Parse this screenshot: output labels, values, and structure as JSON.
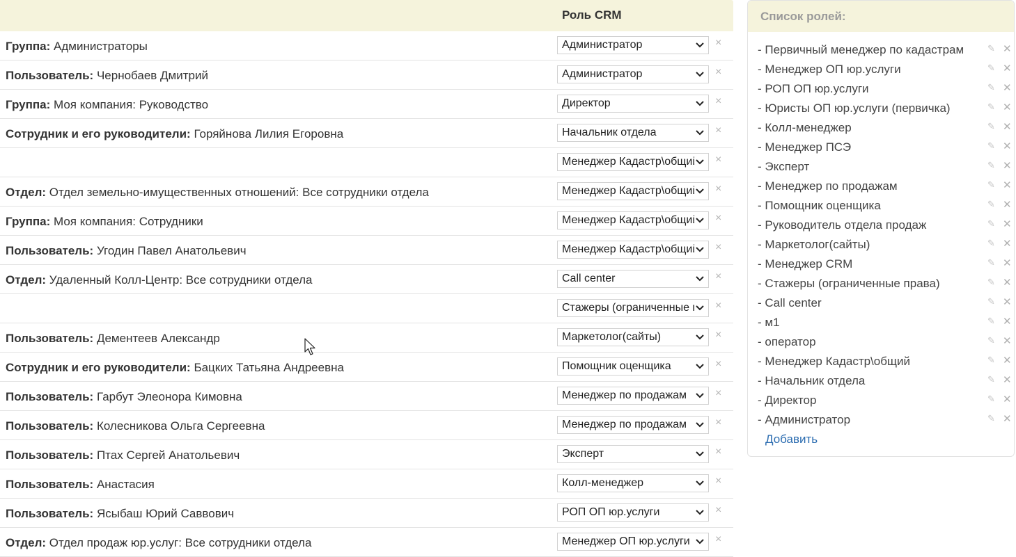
{
  "table": {
    "column_title": "Роль CRM",
    "rows": [
      {
        "type": "Группа:",
        "name": "Администраторы",
        "role": "Администратор"
      },
      {
        "type": "Пользователь:",
        "name": "Чернобаев Дмитрий",
        "role": "Администратор"
      },
      {
        "type": "Группа:",
        "name": "Моя компания: Руководство",
        "role": "Директор"
      },
      {
        "type": "Сотрудник и его руководители:",
        "name": "Горяйнова Лилия Егоровна",
        "role": "Начальник отдела"
      },
      {
        "type": "",
        "name": "",
        "role": "Менеджер Кадастр\\общий"
      },
      {
        "type": "Отдел:",
        "name": "Отдел земельно-имущественных отношений: Все сотрудники отдела",
        "role": "Менеджер Кадастр\\общий"
      },
      {
        "type": "Группа:",
        "name": "Моя компания: Сотрудники",
        "role": "Менеджер Кадастр\\общий"
      },
      {
        "type": "Пользователь:",
        "name": "Угодин Павел Анатольевич",
        "role": "Менеджер Кадастр\\общий"
      },
      {
        "type": "Отдел:",
        "name": "Удаленный Колл-Центр: Все сотрудники отдела",
        "role": "Call center"
      },
      {
        "type": "",
        "name": "",
        "role": "Стажеры (ограниченные права)"
      },
      {
        "type": "Пользователь:",
        "name": "Дементеев Александр",
        "role": "Маркетолог(сайты)"
      },
      {
        "type": "Сотрудник и его руководители:",
        "name": "Бацких Татьяна Андреевна",
        "role": "Помощник оценщика"
      },
      {
        "type": "Пользователь:",
        "name": "Гарбут Элеонора Кимовна",
        "role": "Менеджер по продажам"
      },
      {
        "type": "Пользователь:",
        "name": "Колесникова Ольга Сергеевна",
        "role": "Менеджер по продажам"
      },
      {
        "type": "Пользователь:",
        "name": "Птах Сергей Анатольевич",
        "role": "Эксперт"
      },
      {
        "type": "Пользователь:",
        "name": "Анастасия",
        "role": "Колл-менеджер"
      },
      {
        "type": "Пользователь:",
        "name": "Ясыбаш Юрий Саввович",
        "role": "РОП ОП юр.услуги"
      },
      {
        "type": "Отдел:",
        "name": "Отдел продаж юр.услуг: Все сотрудники отдела",
        "role": "Менеджер ОП юр.услуги"
      }
    ],
    "delete_glyph": "×"
  },
  "roles_panel": {
    "title": "Список ролей:",
    "roles": [
      "- Первичный менеджер по кадастрам",
      "- Менеджер ОП юр.услуги",
      "- РОП ОП юр.услуги",
      "- Юристы ОП юр.услуги (первичка)",
      "- Колл-менеджер",
      "- Менеджер ПСЭ",
      "- Эксперт",
      "- Менеджер по продажам",
      "- Помощник оценщика",
      "- Руководитель отдела продаж",
      "- Маркетолог(сайты)",
      "- Менеджер CRM",
      "- Стажеры (ограниченные права)",
      "- Call center",
      "- м1",
      "- оператор",
      "- Менеджер Кадастр\\общий",
      "- Начальник отдела",
      "- Директор",
      "- Администратор"
    ],
    "edit_glyph": "✎",
    "remove_glyph": "✕",
    "add_label": "Добавить"
  },
  "colors": {
    "header_bg": "#f5f3dc",
    "link": "#2b6cb0",
    "muted": "#b5b5b5"
  }
}
